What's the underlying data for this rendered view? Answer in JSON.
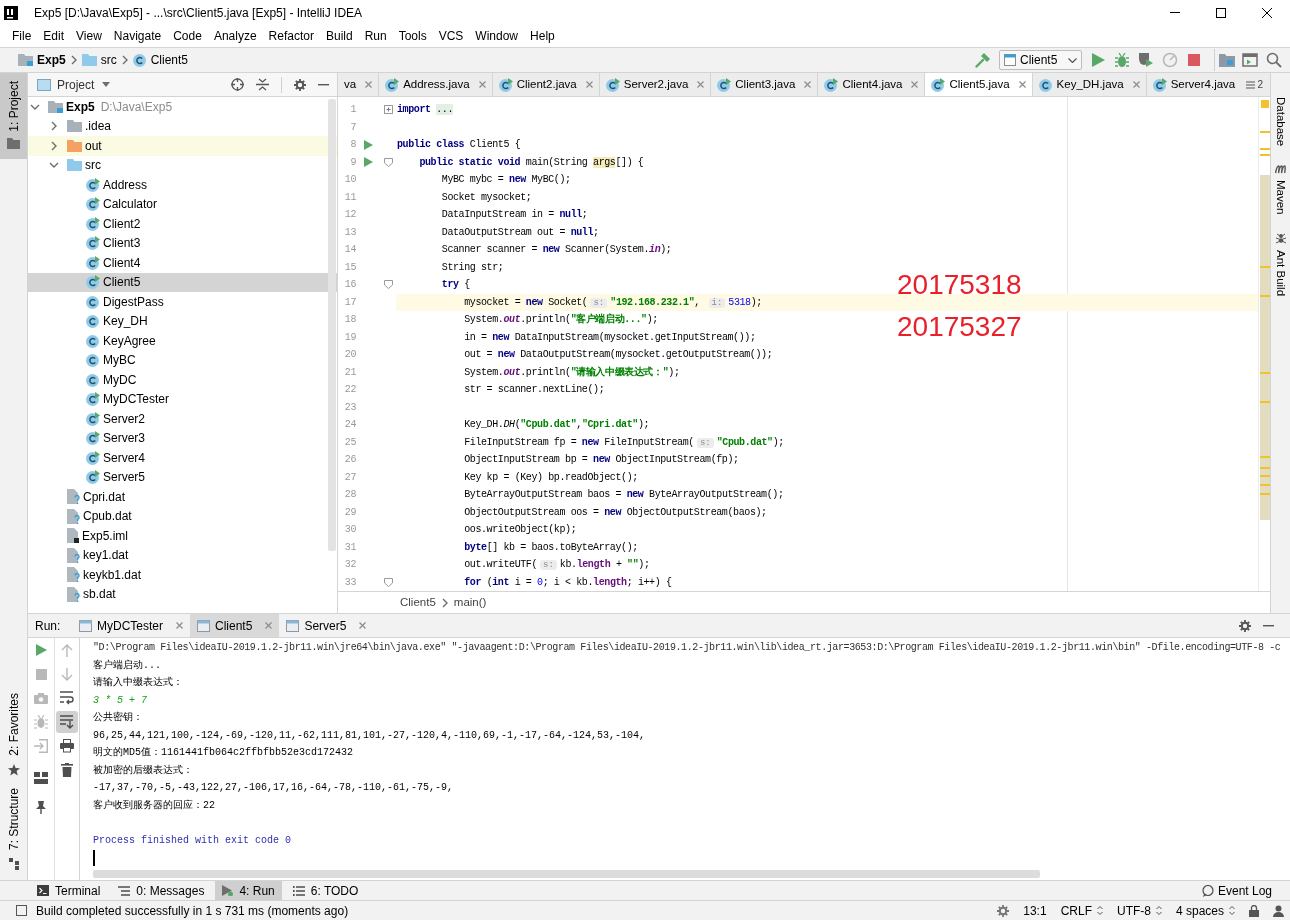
{
  "window": {
    "title": "Exp5 [D:\\Java\\Exp5] - ...\\src\\Client5.java [Exp5] - IntelliJ IDEA"
  },
  "menu": [
    "File",
    "Edit",
    "View",
    "Navigate",
    "Code",
    "Analyze",
    "Refactor",
    "Build",
    "Run",
    "Tools",
    "VCS",
    "Window",
    "Help"
  ],
  "navigation": {
    "breadcrumb": [
      {
        "label": "Exp5",
        "kind": "module"
      },
      {
        "label": "src",
        "kind": "source_folder"
      },
      {
        "label": "Client5",
        "kind": "class"
      }
    ],
    "toolbar": [
      {
        "kind": "build",
        "disabled": false
      },
      {
        "kind": "config",
        "label": "Client5"
      },
      {
        "kind": "run",
        "disabled": false
      },
      {
        "kind": "debug",
        "disabled": false
      },
      {
        "kind": "coverage",
        "disabled": false
      },
      {
        "kind": "profile",
        "disabled": true
      },
      {
        "kind": "stop",
        "disabled": false
      },
      {
        "kind": "structure",
        "disabled": false
      },
      {
        "kind": "window",
        "disabled": false
      },
      {
        "kind": "search",
        "disabled": false
      }
    ]
  },
  "left_strip": {
    "top": [
      {
        "label": "1: Project",
        "kind": "project",
        "selected": true
      }
    ],
    "bottom": [
      {
        "label": "2: Favorites",
        "kind": "favorites",
        "selected": false
      },
      {
        "label": "7: Structure",
        "kind": "structure",
        "selected": false
      }
    ]
  },
  "project": {
    "title": "Project",
    "tree": [
      {
        "label": "Exp5",
        "path": "D:\\Java\\Exp5",
        "kind": "module",
        "expanded": true,
        "selected": false,
        "children": [
          {
            "label": ".idea",
            "kind": "folder",
            "expanded": false,
            "selected": false
          },
          {
            "label": "out",
            "kind": "excluded_folder",
            "expanded": false,
            "selected": false
          },
          {
            "label": "src",
            "kind": "source_folder",
            "expanded": true,
            "selected": false,
            "children": [
              {
                "label": "Address",
                "kind": "class",
                "runnable": true,
                "selected": false
              },
              {
                "label": "Calculator",
                "kind": "class",
                "runnable": true,
                "selected": false
              },
              {
                "label": "Client2",
                "kind": "class",
                "runnable": true,
                "selected": false
              },
              {
                "label": "Client3",
                "kind": "class",
                "runnable": true,
                "selected": false
              },
              {
                "label": "Client4",
                "kind": "class",
                "runnable": true,
                "selected": false
              },
              {
                "label": "Client5",
                "kind": "class",
                "runnable": true,
                "selected": true
              },
              {
                "label": "DigestPass",
                "kind": "class",
                "runnable": false,
                "selected": false
              },
              {
                "label": "Key_DH",
                "kind": "class",
                "runnable": false,
                "selected": false
              },
              {
                "label": "KeyAgree",
                "kind": "class",
                "runnable": false,
                "selected": false
              },
              {
                "label": "MyBC",
                "kind": "class",
                "runnable": false,
                "selected": false
              },
              {
                "label": "MyDC",
                "kind": "class",
                "runnable": false,
                "selected": false
              },
              {
                "label": "MyDCTester",
                "kind": "class",
                "runnable": true,
                "selected": false
              },
              {
                "label": "Server2",
                "kind": "class",
                "runnable": true,
                "selected": false
              },
              {
                "label": "Server3",
                "kind": "class",
                "runnable": true,
                "selected": false
              },
              {
                "label": "Server4",
                "kind": "class",
                "runnable": true,
                "selected": false
              },
              {
                "label": "Server5",
                "kind": "class",
                "runnable": true,
                "selected": false
              }
            ]
          },
          {
            "label": "Cpri.dat",
            "kind": "unknown_file",
            "selected": false
          },
          {
            "label": "Cpub.dat",
            "kind": "unknown_file",
            "selected": false
          },
          {
            "label": "Exp5.iml",
            "kind": "module_file",
            "selected": false
          },
          {
            "label": "key1.dat",
            "kind": "unknown_file",
            "selected": false
          },
          {
            "label": "keykb1.dat",
            "kind": "unknown_file",
            "selected": false
          },
          {
            "label": "sb.dat",
            "kind": "unknown_file",
            "selected": false
          }
        ]
      }
    ]
  },
  "editor": {
    "tabs": [
      {
        "label": "va",
        "kind": "partial",
        "selected": false
      },
      {
        "label": "Address.java",
        "kind": "class",
        "runnable": true,
        "selected": false
      },
      {
        "label": "Client2.java",
        "kind": "class",
        "runnable": true,
        "selected": false
      },
      {
        "label": "Server2.java",
        "kind": "class",
        "runnable": true,
        "selected": false
      },
      {
        "label": "Client3.java",
        "kind": "class",
        "runnable": true,
        "selected": false
      },
      {
        "label": "Client4.java",
        "kind": "class",
        "runnable": true,
        "selected": false
      },
      {
        "label": "Client5.java",
        "kind": "class",
        "runnable": true,
        "selected": true
      },
      {
        "label": "Key_DH.java",
        "kind": "class",
        "runnable": false,
        "selected": false
      },
      {
        "label": "Server4.java",
        "kind": "class",
        "runnable": true,
        "selected": false
      }
    ],
    "overflow": "2",
    "lines": [
      {
        "number": "1",
        "collapsed": true,
        "segments": [
          {
            "kind": "keyword",
            "text": "import "
          },
          {
            "kind": "folded",
            "text": "..."
          }
        ]
      },
      {
        "number": "7"
      },
      {
        "number": "8",
        "run_icon": true,
        "segments": [
          {
            "kind": "keyword",
            "text": "public class "
          },
          {
            "kind": "plain",
            "text": "Client5 {"
          }
        ]
      },
      {
        "number": "9",
        "run_icon": true,
        "collapsed": false,
        "segments": [
          {
            "kind": "keyword",
            "text": "    public static void "
          },
          {
            "kind": "plain",
            "text": "main(String "
          },
          {
            "kind": "param",
            "text": "args"
          },
          {
            "kind": "plain",
            "text": "[]) {"
          }
        ]
      },
      {
        "number": "10",
        "segments": [
          {
            "kind": "plain",
            "text": "        MyBC mybc = "
          },
          {
            "kind": "keyword",
            "text": "new "
          },
          {
            "kind": "plain",
            "text": "MyBC();"
          }
        ]
      },
      {
        "number": "11",
        "segments": [
          {
            "kind": "plain",
            "text": "        Socket mysocket;"
          }
        ]
      },
      {
        "number": "12",
        "segments": [
          {
            "kind": "plain",
            "text": "        DataInputStream in = "
          },
          {
            "kind": "keyword",
            "text": "null"
          },
          {
            "kind": "plain",
            "text": ";"
          }
        ]
      },
      {
        "number": "13",
        "segments": [
          {
            "kind": "plain",
            "text": "        DataOutputStream out = "
          },
          {
            "kind": "keyword",
            "text": "null"
          },
          {
            "kind": "plain",
            "text": ";"
          }
        ]
      },
      {
        "number": "14",
        "segments": [
          {
            "kind": "plain",
            "text": "        Scanner scanner = "
          },
          {
            "kind": "keyword",
            "text": "new "
          },
          {
            "kind": "plain",
            "text": "Scanner(System."
          },
          {
            "kind": "static_field",
            "text": "in"
          },
          {
            "kind": "plain",
            "text": ");"
          }
        ]
      },
      {
        "number": "15",
        "segments": [
          {
            "kind": "plain",
            "text": "        String str;"
          }
        ]
      },
      {
        "number": "16",
        "collapsed": false,
        "segments": [
          {
            "kind": "keyword",
            "text": "        try "
          },
          {
            "kind": "plain",
            "text": "{"
          }
        ]
      },
      {
        "number": "17",
        "current": true,
        "segments": [
          {
            "kind": "plain",
            "text": "            mysocket = "
          },
          {
            "kind": "keyword",
            "text": "new "
          },
          {
            "kind": "plain",
            "text": "Socket("
          },
          {
            "kind": "hint",
            "text": "s:"
          },
          {
            "kind": "string",
            "text": "\"192.168.232.1\""
          },
          {
            "kind": "plain",
            "text": ", "
          },
          {
            "kind": "hint",
            "text": "i:"
          },
          {
            "kind": "number",
            "text": "5318"
          },
          {
            "kind": "plain",
            "text": ");"
          }
        ]
      },
      {
        "number": "18",
        "segments": [
          {
            "kind": "plain",
            "text": "            System."
          },
          {
            "kind": "static_field",
            "text": "out"
          },
          {
            "kind": "plain",
            "text": ".println("
          },
          {
            "kind": "string",
            "text": "\"客户端启动...\""
          },
          {
            "kind": "plain",
            "text": ");"
          }
        ]
      },
      {
        "number": "19",
        "segments": [
          {
            "kind": "plain",
            "text": "            in = "
          },
          {
            "kind": "keyword",
            "text": "new "
          },
          {
            "kind": "plain",
            "text": "DataInputStream(mysocket.getInputStream());"
          }
        ]
      },
      {
        "number": "20",
        "segments": [
          {
            "kind": "plain",
            "text": "            out = "
          },
          {
            "kind": "keyword",
            "text": "new "
          },
          {
            "kind": "plain",
            "text": "DataOutputStream(mysocket.getOutputStream());"
          }
        ]
      },
      {
        "number": "21",
        "segments": [
          {
            "kind": "plain",
            "text": "            System."
          },
          {
            "kind": "static_field",
            "text": "out"
          },
          {
            "kind": "plain",
            "text": ".println("
          },
          {
            "kind": "string",
            "text": "\"请输入中缀表达式：\""
          },
          {
            "kind": "plain",
            "text": ");"
          }
        ]
      },
      {
        "number": "22",
        "segments": [
          {
            "kind": "plain",
            "text": "            str = scanner.nextLine();"
          }
        ]
      },
      {
        "number": "23"
      },
      {
        "number": "24",
        "segments": [
          {
            "kind": "plain",
            "text": "            Key_DH."
          },
          {
            "kind": "static_method",
            "text": "DH"
          },
          {
            "kind": "plain",
            "text": "("
          },
          {
            "kind": "string",
            "text": "\"Cpub.dat\""
          },
          {
            "kind": "plain",
            "text": ","
          },
          {
            "kind": "string",
            "text": "\"Cpri.dat\""
          },
          {
            "kind": "plain",
            "text": ");"
          }
        ]
      },
      {
        "number": "25",
        "segments": [
          {
            "kind": "plain",
            "text": "            FileInputStream fp = "
          },
          {
            "kind": "keyword",
            "text": "new "
          },
          {
            "kind": "plain",
            "text": "FileInputStream("
          },
          {
            "kind": "hint",
            "text": "s:"
          },
          {
            "kind": "string",
            "text": "\"Cpub.dat\""
          },
          {
            "kind": "plain",
            "text": ");"
          }
        ]
      },
      {
        "number": "26",
        "segments": [
          {
            "kind": "plain",
            "text": "            ObjectInputStream bp = "
          },
          {
            "kind": "keyword",
            "text": "new "
          },
          {
            "kind": "plain",
            "text": "ObjectInputStream(fp);"
          }
        ]
      },
      {
        "number": "27",
        "segments": [
          {
            "kind": "plain",
            "text": "            Key kp = (Key) bp.readObject();"
          }
        ]
      },
      {
        "number": "28",
        "segments": [
          {
            "kind": "plain",
            "text": "            ByteArrayOutputStream baos = "
          },
          {
            "kind": "keyword",
            "text": "new "
          },
          {
            "kind": "plain",
            "text": "ByteArrayOutputStream();"
          }
        ]
      },
      {
        "number": "29",
        "segments": [
          {
            "kind": "plain",
            "text": "            ObjectOutputStream oos = "
          },
          {
            "kind": "keyword",
            "text": "new "
          },
          {
            "kind": "plain",
            "text": "ObjectOutputStream(baos);"
          }
        ]
      },
      {
        "number": "30",
        "segments": [
          {
            "kind": "plain",
            "text": "            oos.writeObject(kp);"
          }
        ]
      },
      {
        "number": "31",
        "segments": [
          {
            "kind": "keyword",
            "text": "            byte"
          },
          {
            "kind": "plain",
            "text": "[] kb = baos.toByteArray();"
          }
        ]
      },
      {
        "number": "32",
        "segments": [
          {
            "kind": "plain",
            "text": "            out.writeUTF("
          },
          {
            "kind": "hint",
            "text": "s:"
          },
          {
            "kind": "plain",
            "text": "kb."
          },
          {
            "kind": "field",
            "text": "length"
          },
          {
            "kind": "plain",
            "text": " + "
          },
          {
            "kind": "string",
            "text": "\"\""
          },
          {
            "kind": "plain",
            "text": ");"
          }
        ]
      },
      {
        "number": "33",
        "collapsed": false,
        "segments": [
          {
            "kind": "keyword",
            "text": "            for "
          },
          {
            "kind": "plain",
            "text": "("
          },
          {
            "kind": "keyword",
            "text": "int "
          },
          {
            "kind": "plain",
            "text": "i = "
          },
          {
            "kind": "number",
            "text": "0"
          },
          {
            "kind": "plain",
            "text": "; i < kb."
          },
          {
            "kind": "field",
            "text": "length"
          },
          {
            "kind": "plain",
            "text": "; i++) {"
          }
        ]
      }
    ],
    "annotations": [
      "20175318",
      "20175327"
    ],
    "breadcrumb": [
      "Client5",
      "main()"
    ]
  },
  "right_strip": [
    {
      "label": "Database",
      "kind": "database"
    },
    {
      "label": "Maven",
      "kind": "maven"
    },
    {
      "label": "Ant Build",
      "kind": "ant"
    }
  ],
  "run": {
    "label": "Run:",
    "tabs": [
      {
        "label": "MyDCTester",
        "selected": false
      },
      {
        "label": "Client5",
        "selected": true
      },
      {
        "label": "Server5",
        "selected": false
      }
    ],
    "toolbar_main": [
      {
        "kind": "rerun",
        "disabled": false
      },
      {
        "kind": "stop",
        "disabled": true
      },
      {
        "kind": "dump",
        "disabled": true
      },
      {
        "kind": "debug",
        "disabled": true
      },
      {
        "kind": "exit",
        "disabled": true
      },
      {
        "kind": "layout",
        "disabled": false
      },
      {
        "kind": "pin",
        "disabled": false
      }
    ],
    "toolbar_side": [
      {
        "kind": "up",
        "disabled": true,
        "toggled": false
      },
      {
        "kind": "down",
        "disabled": true,
        "toggled": false
      },
      {
        "kind": "wrap",
        "disabled": false,
        "toggled": false
      },
      {
        "kind": "scroll_end",
        "disabled": false,
        "toggled": true
      },
      {
        "kind": "print",
        "disabled": false,
        "toggled": false
      },
      {
        "kind": "clear",
        "disabled": false,
        "toggled": false
      }
    ],
    "console": [
      {
        "kind": "command",
        "text": "\"D:\\Program Files\\ideaIU-2019.1.2-jbr11.win\\jre64\\bin\\java.exe\" \"-javaagent:D:\\Program Files\\ideaIU-2019.1.2-jbr11.win\\lib\\idea_rt.jar=3653:D:\\Program Files\\ideaIU-2019.1.2-jbr11.win\\bin\" -Dfile.encoding=UTF-8 -c"
      },
      {
        "kind": "output",
        "text": "客户端启动..."
      },
      {
        "kind": "output",
        "text": "请输入中缀表达式："
      },
      {
        "kind": "input",
        "text": "3 * 5 + 7"
      },
      {
        "kind": "output",
        "text": "公共密钥："
      },
      {
        "kind": "output",
        "text": "96,25,44,121,100,-124,-69,-120,11,-62,111,81,101,-27,-120,4,-110,69,-1,-17,-64,-124,53,-104,"
      },
      {
        "kind": "output",
        "text": "明文的MD5值：1161441fb064c2ffbfbb52e3cd172432"
      },
      {
        "kind": "output",
        "text": "被加密的后缀表达式："
      },
      {
        "kind": "output",
        "text": "-17,37,-70,-5,-43,122,27,-106,17,16,-64,-78,-110,-61,-75,-9,"
      },
      {
        "kind": "output",
        "text": "客户收到服务器的回应：22"
      },
      {
        "kind": "exit",
        "text": "Process finished with exit code 0"
      }
    ]
  },
  "bottom_tabs": [
    {
      "label": "Terminal",
      "kind": "terminal",
      "selected": false
    },
    {
      "label": "0: Messages",
      "kind": "messages",
      "selected": false
    },
    {
      "label": "4: Run",
      "kind": "run",
      "selected": true
    },
    {
      "label": "6: TODO",
      "kind": "todo",
      "selected": false
    }
  ],
  "event_log": "Event Log",
  "status_bar": {
    "message": "Build completed successfully in 1 s 731 ms (moments ago)",
    "position": "13:1",
    "line_separator": "CRLF",
    "encoding": "UTF-8",
    "indent": "4 spaces"
  }
}
